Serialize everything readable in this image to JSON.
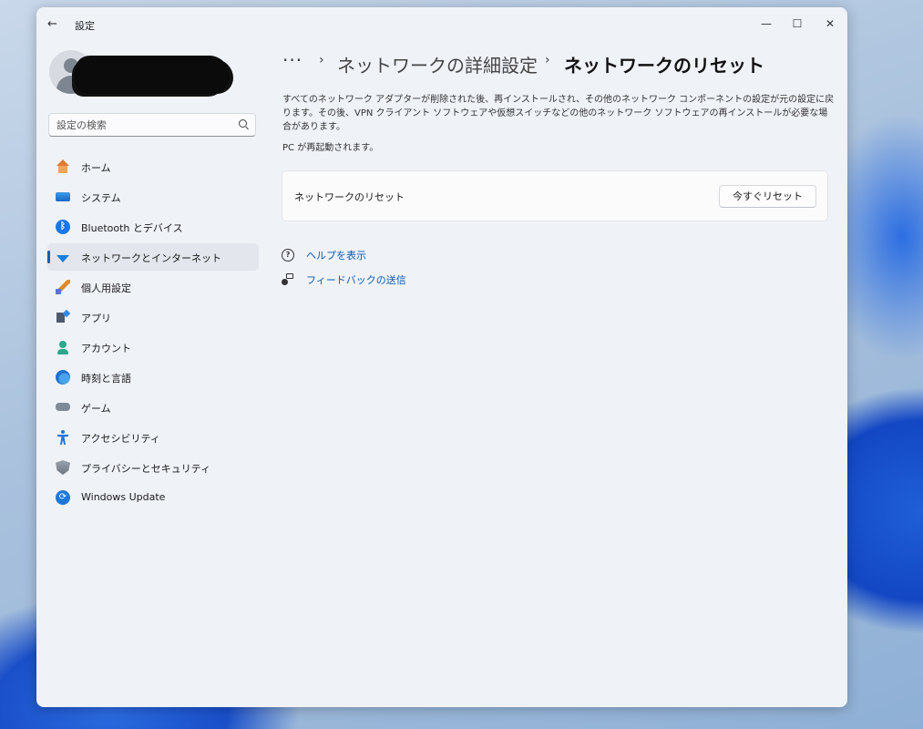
{
  "window": {
    "title": "設定",
    "back_glyph": "←",
    "minimize_glyph": "—",
    "maximize_glyph": "☐",
    "close_glyph": "✕"
  },
  "search": {
    "placeholder": "設定の検索",
    "value": ""
  },
  "sidebar": {
    "items": [
      {
        "label": "ホーム",
        "icon": "home-icon",
        "active": false
      },
      {
        "label": "システム",
        "icon": "system-icon",
        "active": false
      },
      {
        "label": "Bluetooth とデバイス",
        "icon": "bluetooth-icon",
        "active": false
      },
      {
        "label": "ネットワークとインターネット",
        "icon": "network-icon",
        "active": true
      },
      {
        "label": "個人用設定",
        "icon": "personalization-icon",
        "active": false
      },
      {
        "label": "アプリ",
        "icon": "apps-icon",
        "active": false
      },
      {
        "label": "アカウント",
        "icon": "account-icon",
        "active": false
      },
      {
        "label": "時刻と言語",
        "icon": "time-language-icon",
        "active": false
      },
      {
        "label": "ゲーム",
        "icon": "gaming-icon",
        "active": false
      },
      {
        "label": "アクセシビリティ",
        "icon": "accessibility-icon",
        "active": false
      },
      {
        "label": "プライバシーとセキュリティ",
        "icon": "privacy-icon",
        "active": false
      },
      {
        "label": "Windows Update",
        "icon": "windows-update-icon",
        "active": false
      }
    ]
  },
  "breadcrumb": {
    "more": "···",
    "separator": "›",
    "parent": "ネットワークの詳細設定",
    "current": "ネットワークのリセット"
  },
  "main": {
    "description": "すべてのネットワーク アダプターが削除された後、再インストールされ、その他のネットワーク コンポーネントの設定が元の設定に戻ります。その後、VPN クライアント ソフトウェアや仮想スイッチなどの他のネットワーク ソフトウェアの再インストールが必要な場合があります。",
    "restart_note": "PC が再起動されます。",
    "reset_card": {
      "label": "ネットワークのリセット",
      "button_label": "今すぐリセット"
    },
    "links": [
      {
        "label": "ヘルプを表示",
        "icon": "help-icon"
      },
      {
        "label": "フィードバックの送信",
        "icon": "feedback-icon"
      }
    ]
  },
  "colors": {
    "accent": "#005fb8",
    "link": "#0a5bb4",
    "window_bg": "#eff2f7",
    "active_nav_bg": "#e3e6ec"
  }
}
